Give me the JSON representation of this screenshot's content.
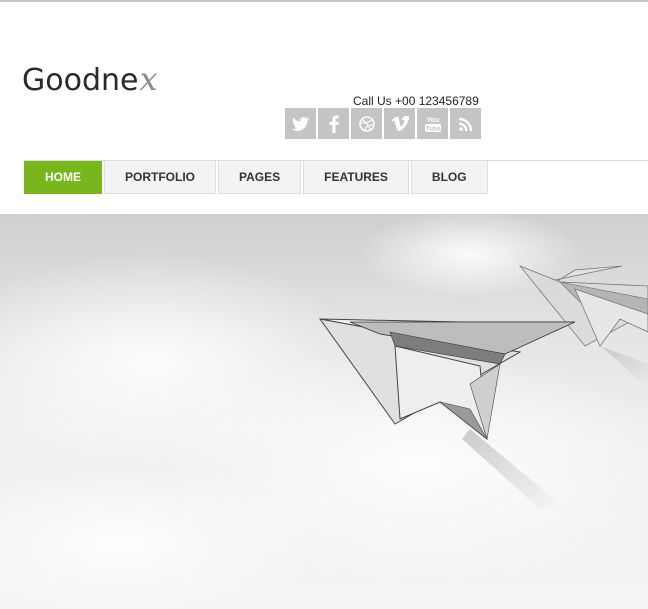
{
  "logo": {
    "main": "Goodne",
    "script": "x"
  },
  "header": {
    "callus": "Call Us +00 123456789"
  },
  "social": [
    {
      "name": "twitter-icon"
    },
    {
      "name": "facebook-icon"
    },
    {
      "name": "dribbble-icon"
    },
    {
      "name": "vimeo-icon"
    },
    {
      "name": "youtube-icon",
      "label": "You Tube"
    },
    {
      "name": "rss-icon"
    }
  ],
  "nav": {
    "items": [
      {
        "label": "HOME",
        "active": true
      },
      {
        "label": "PORTFOLIO",
        "active": false
      },
      {
        "label": "PAGES",
        "active": false
      },
      {
        "label": "FEATURES",
        "active": false
      },
      {
        "label": "BLOG",
        "active": false
      }
    ]
  },
  "colors": {
    "accent": "#79b51c",
    "social_bg": "#c4c4c4",
    "nav_bg": "#f3f3f3"
  },
  "hero": {
    "image": "paper-planes-illustration"
  }
}
